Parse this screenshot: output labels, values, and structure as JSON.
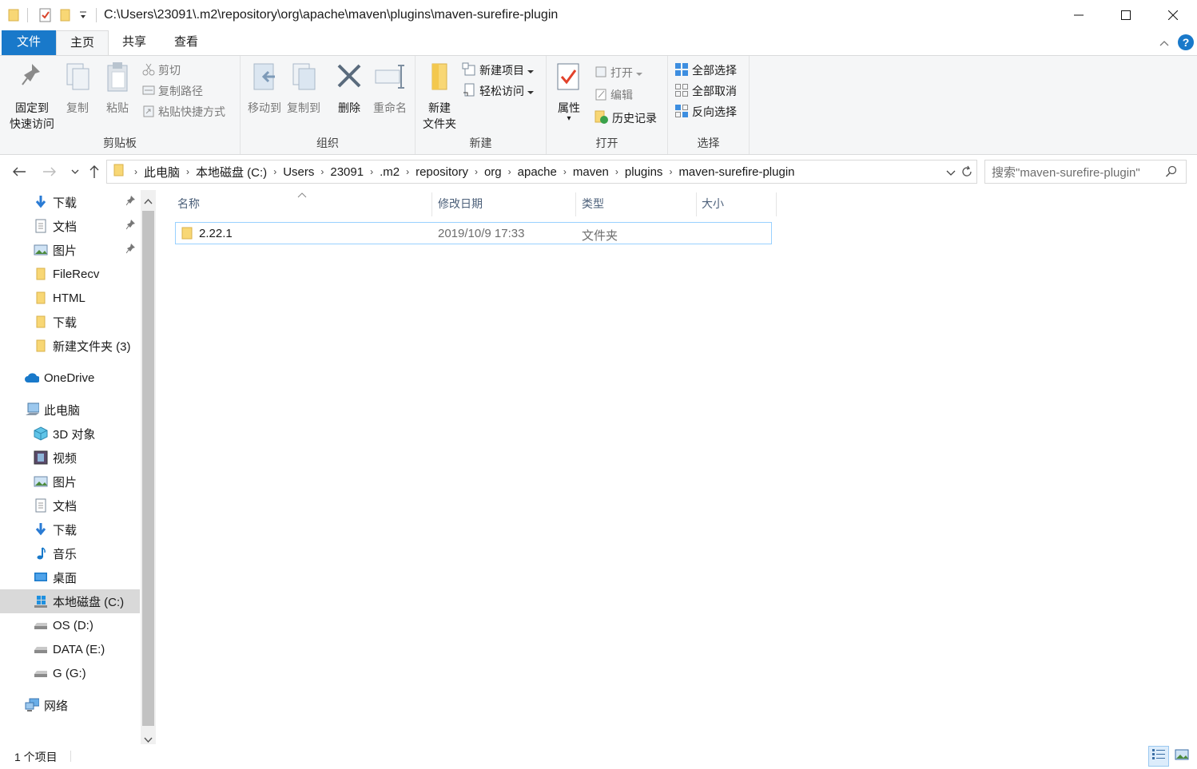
{
  "window": {
    "title": "C:\\Users\\23091\\.m2\\repository\\org\\apache\\maven\\plugins\\maven-surefire-plugin"
  },
  "tabs": [
    {
      "label": "文件"
    },
    {
      "label": "主页"
    },
    {
      "label": "共享"
    },
    {
      "label": "查看"
    }
  ],
  "ribbon": {
    "clipboard": {
      "pin_label_1": "固定到",
      "pin_label_2": "快速访问",
      "copy": "复制",
      "paste": "粘贴",
      "cut": "剪切",
      "copy_path": "复制路径",
      "paste_shortcut": "粘贴快捷方式",
      "group": "剪贴板"
    },
    "organize": {
      "move_to": "移动到",
      "copy_to": "复制到",
      "delete": "删除",
      "rename": "重命名",
      "group": "组织"
    },
    "new": {
      "new_folder_1": "新建",
      "new_folder_2": "文件夹",
      "new_item": "新建项目",
      "easy_access": "轻松访问",
      "group": "新建"
    },
    "open": {
      "properties": "属性",
      "open": "打开",
      "edit": "编辑",
      "history": "历史记录",
      "group": "打开"
    },
    "select": {
      "select_all": "全部选择",
      "select_none": "全部取消",
      "invert": "反向选择",
      "group": "选择"
    }
  },
  "address": {
    "crumbs": [
      "此电脑",
      "本地磁盘 (C:)",
      "Users",
      "23091",
      ".m2",
      "repository",
      "org",
      "apache",
      "maven",
      "plugins",
      "maven-surefire-plugin"
    ]
  },
  "search": {
    "placeholder": "搜索\"maven-surefire-plugin\""
  },
  "nav": {
    "items": [
      {
        "label": "下载"
      },
      {
        "label": "文档"
      },
      {
        "label": "图片"
      },
      {
        "label": "FileRecv"
      },
      {
        "label": "HTML"
      },
      {
        "label": "下载"
      },
      {
        "label": "新建文件夹 (3)"
      },
      {
        "label": "OneDrive"
      },
      {
        "label": "此电脑"
      },
      {
        "label": "3D 对象"
      },
      {
        "label": "视频"
      },
      {
        "label": "图片"
      },
      {
        "label": "文档"
      },
      {
        "label": "下载"
      },
      {
        "label": "音乐"
      },
      {
        "label": "桌面"
      },
      {
        "label": "本地磁盘 (C:)"
      },
      {
        "label": "OS (D:)"
      },
      {
        "label": "DATA (E:)"
      },
      {
        "label": "G (G:)"
      },
      {
        "label": "网络"
      }
    ]
  },
  "columns": {
    "name": "名称",
    "modified": "修改日期",
    "type": "类型",
    "size": "大小"
  },
  "files": [
    {
      "name": "2.22.1",
      "modified": "2019/10/9 17:33",
      "type": "文件夹",
      "size": ""
    }
  ],
  "status": {
    "count": "1 个项目"
  },
  "colors": {
    "accent": "#1979ca",
    "folder": "#f8d775",
    "selection_border": "#99d1ff"
  }
}
